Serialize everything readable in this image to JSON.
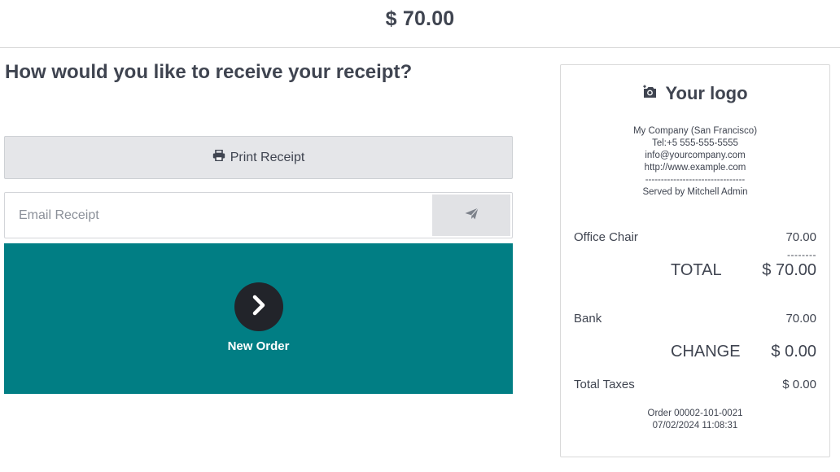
{
  "header": {
    "amount": "$ 70.00"
  },
  "receipt_prompt": {
    "question": "How would you like to receive your receipt?",
    "print_label": "Print Receipt",
    "email_placeholder": "Email Receipt",
    "new_order_label": "New Order"
  },
  "receipt": {
    "logo_text": "Your logo",
    "company_lines": [
      "My Company (San Francisco)",
      "Tel:+5 555-555-5555",
      "info@yourcompany.com",
      "http://www.example.com",
      "--------------------------------",
      "Served by Mitchell Admin"
    ],
    "lines": [
      {
        "name": "Office Chair",
        "amount": "70.00"
      }
    ],
    "separator": "--------",
    "total_label": "TOTAL",
    "total_amount": "$ 70.00",
    "payment_method": "Bank",
    "payment_amount": "70.00",
    "change_label": "CHANGE",
    "change_amount": "$ 0.00",
    "taxes_label": "Total Taxes",
    "taxes_amount": "$ 0.00",
    "order_ref": "Order 00002-101-0021",
    "order_date": "07/02/2024 11:08:31"
  },
  "icons": {
    "print": "printer-icon",
    "send": "paper-plane-icon",
    "next": "chevron-right-icon",
    "camera": "camera-icon"
  },
  "colors": {
    "accent": "#017e84",
    "button_bg": "#e5e6e9",
    "circle": "#22242a"
  }
}
